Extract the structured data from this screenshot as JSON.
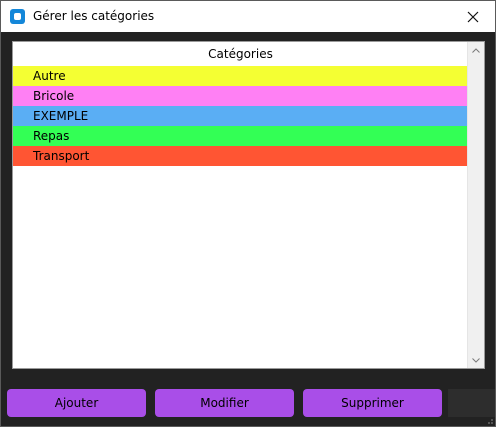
{
  "window": {
    "title": "Gérer les catégories",
    "icon": "app-icon",
    "close_icon": "close-icon"
  },
  "list": {
    "header": "Catégories",
    "items": [
      {
        "label": "Autre",
        "color": "#f4ff33"
      },
      {
        "label": "Bricole",
        "color": "#ff80f4"
      },
      {
        "label": "EXEMPLE",
        "color": "#5aaef4"
      },
      {
        "label": "Repas",
        "color": "#33ff55"
      },
      {
        "label": "Transport",
        "color": "#ff5533"
      }
    ]
  },
  "buttons": {
    "add_label": "Ajouter",
    "edit_label": "Modifier",
    "delete_label": "Supprimer",
    "color": "#a94ee8"
  }
}
